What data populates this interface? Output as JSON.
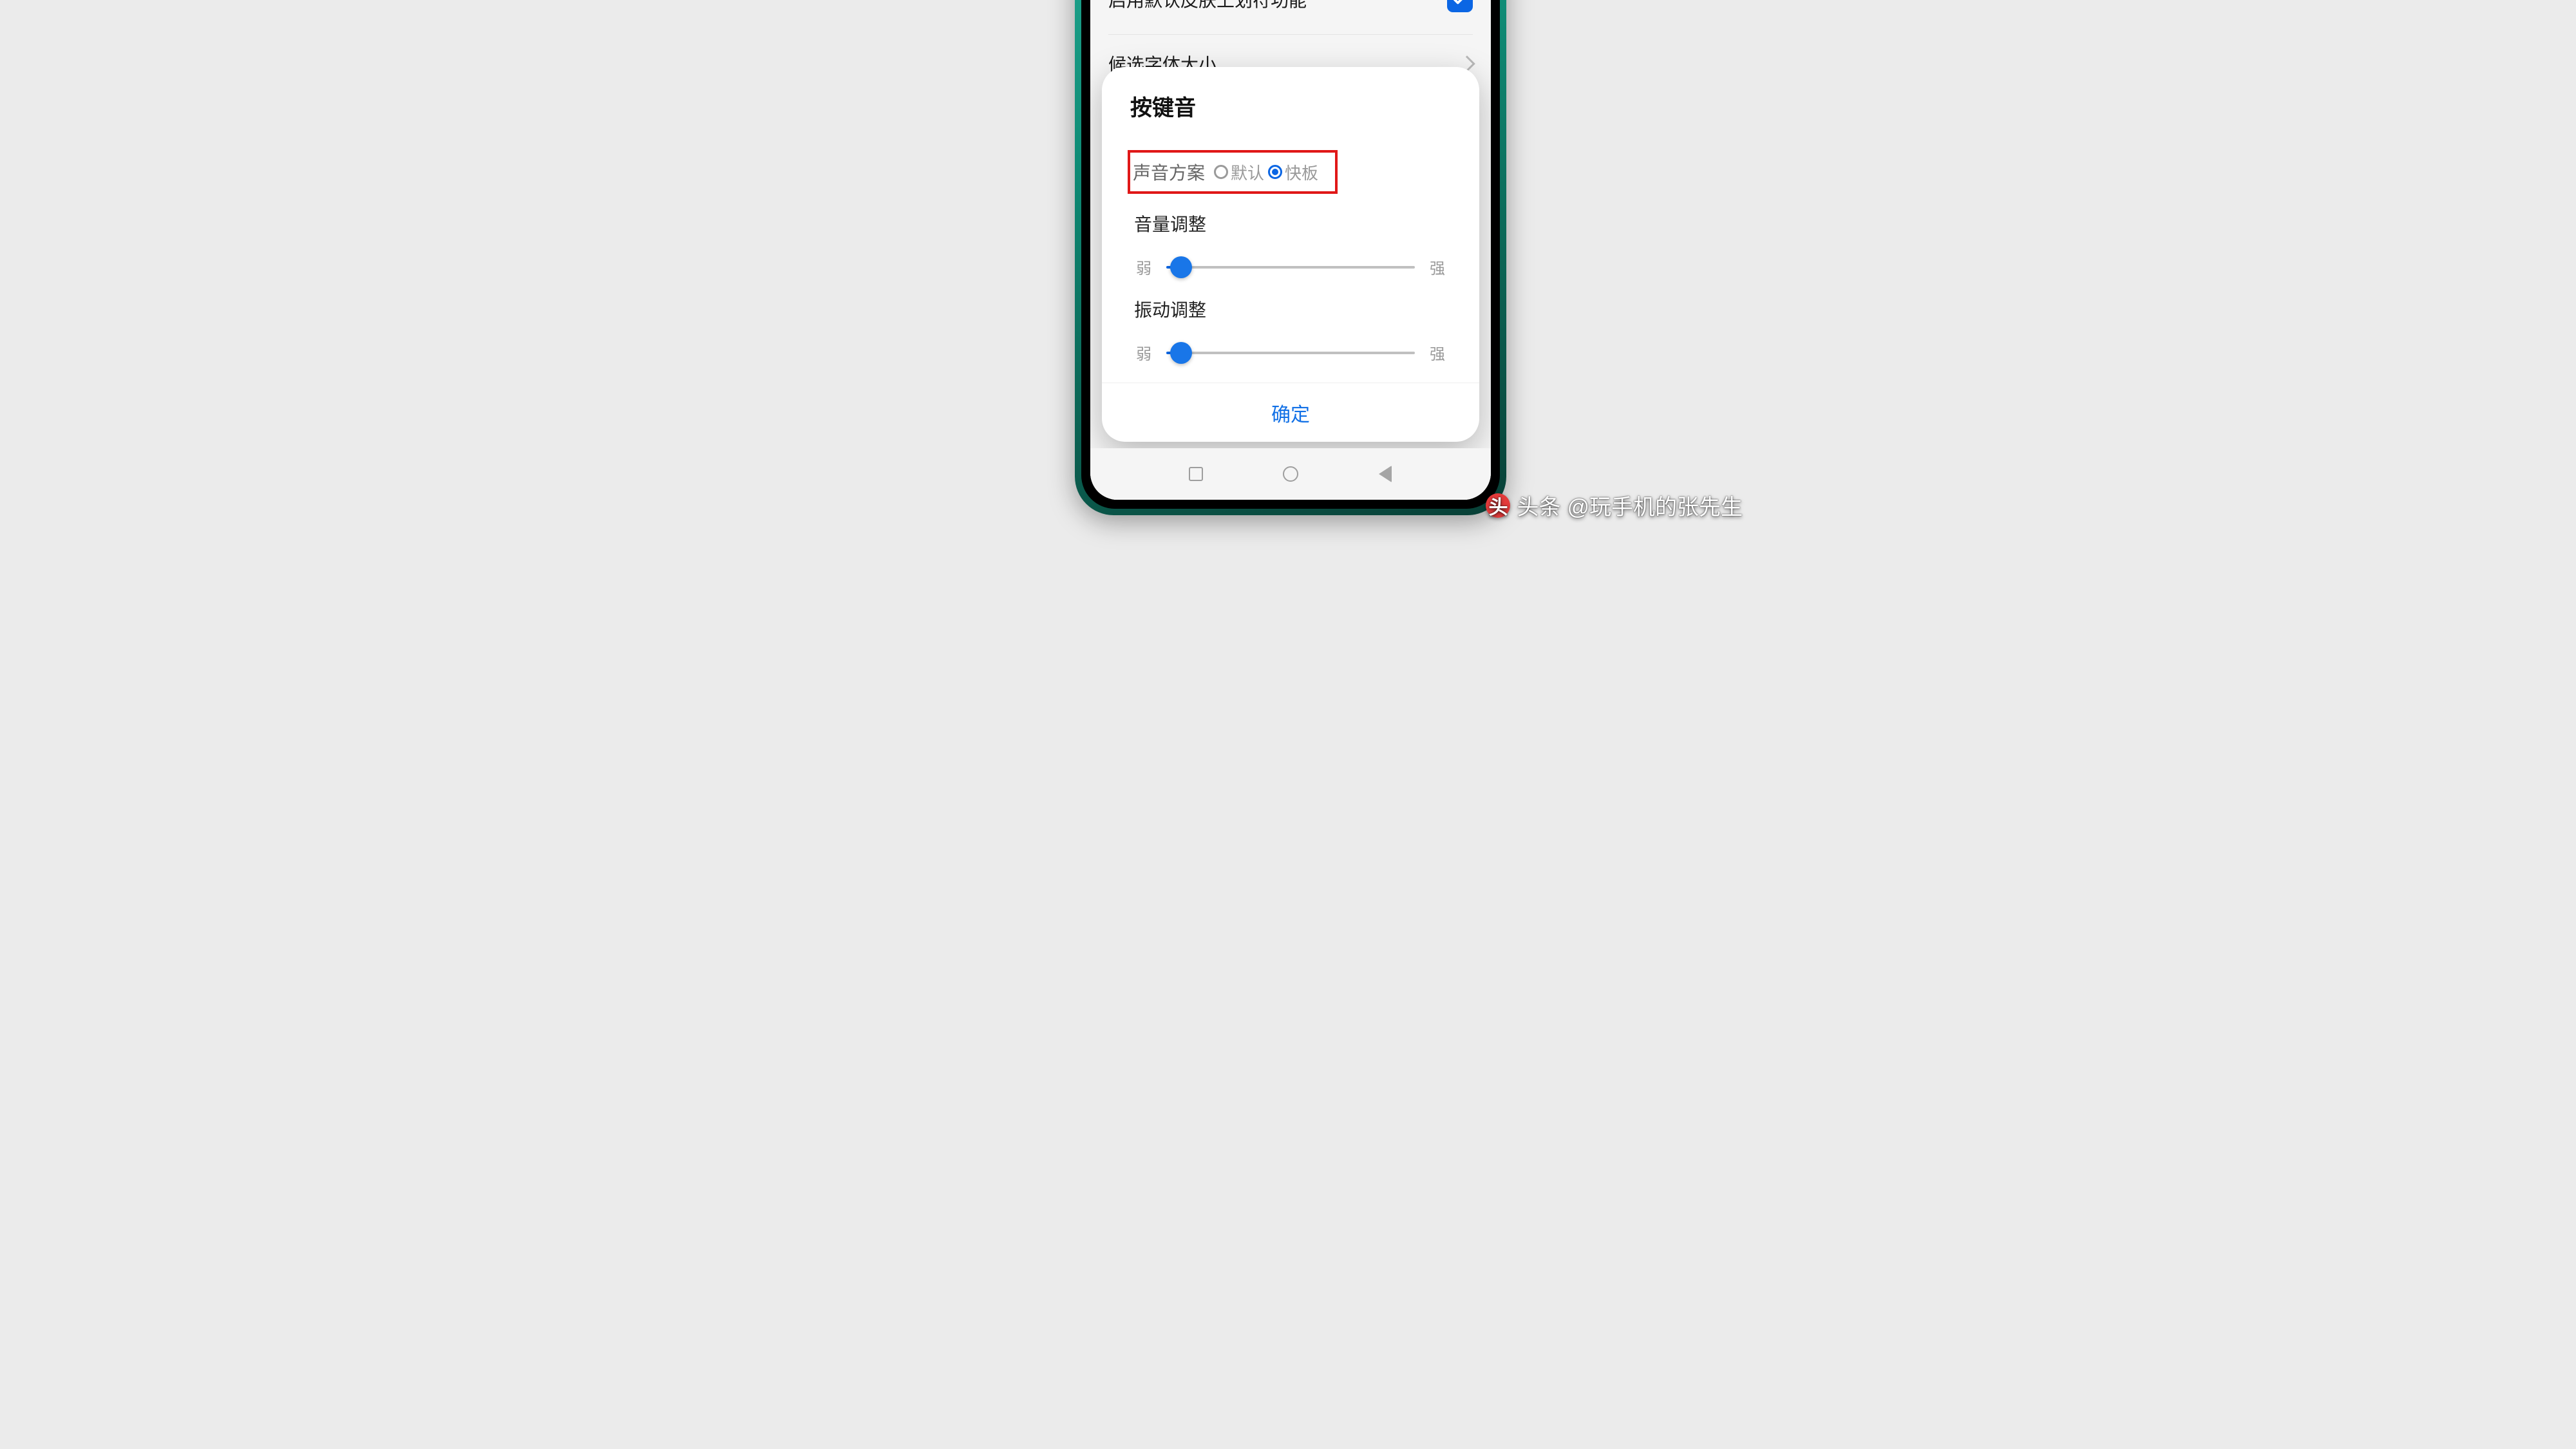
{
  "background": {
    "row1_label": "启用默认皮肤上划符功能",
    "row1_checked": true,
    "row2_label": "候选字体大小"
  },
  "modal": {
    "title": "按键音",
    "sound_scheme": {
      "label": "声音方案",
      "options": [
        {
          "label": "默认",
          "selected": false
        },
        {
          "label": "快板",
          "selected": true
        }
      ]
    },
    "volume": {
      "title": "音量调整",
      "min_label": "弱",
      "max_label": "强",
      "value_pct": 6
    },
    "vibration": {
      "title": "振动调整",
      "min_label": "弱",
      "max_label": "强",
      "value_pct": 6
    },
    "confirm": "确定"
  },
  "watermark": {
    "brand": "头条",
    "handle": "@玩手机的张先生",
    "logo_glyph": "头"
  }
}
